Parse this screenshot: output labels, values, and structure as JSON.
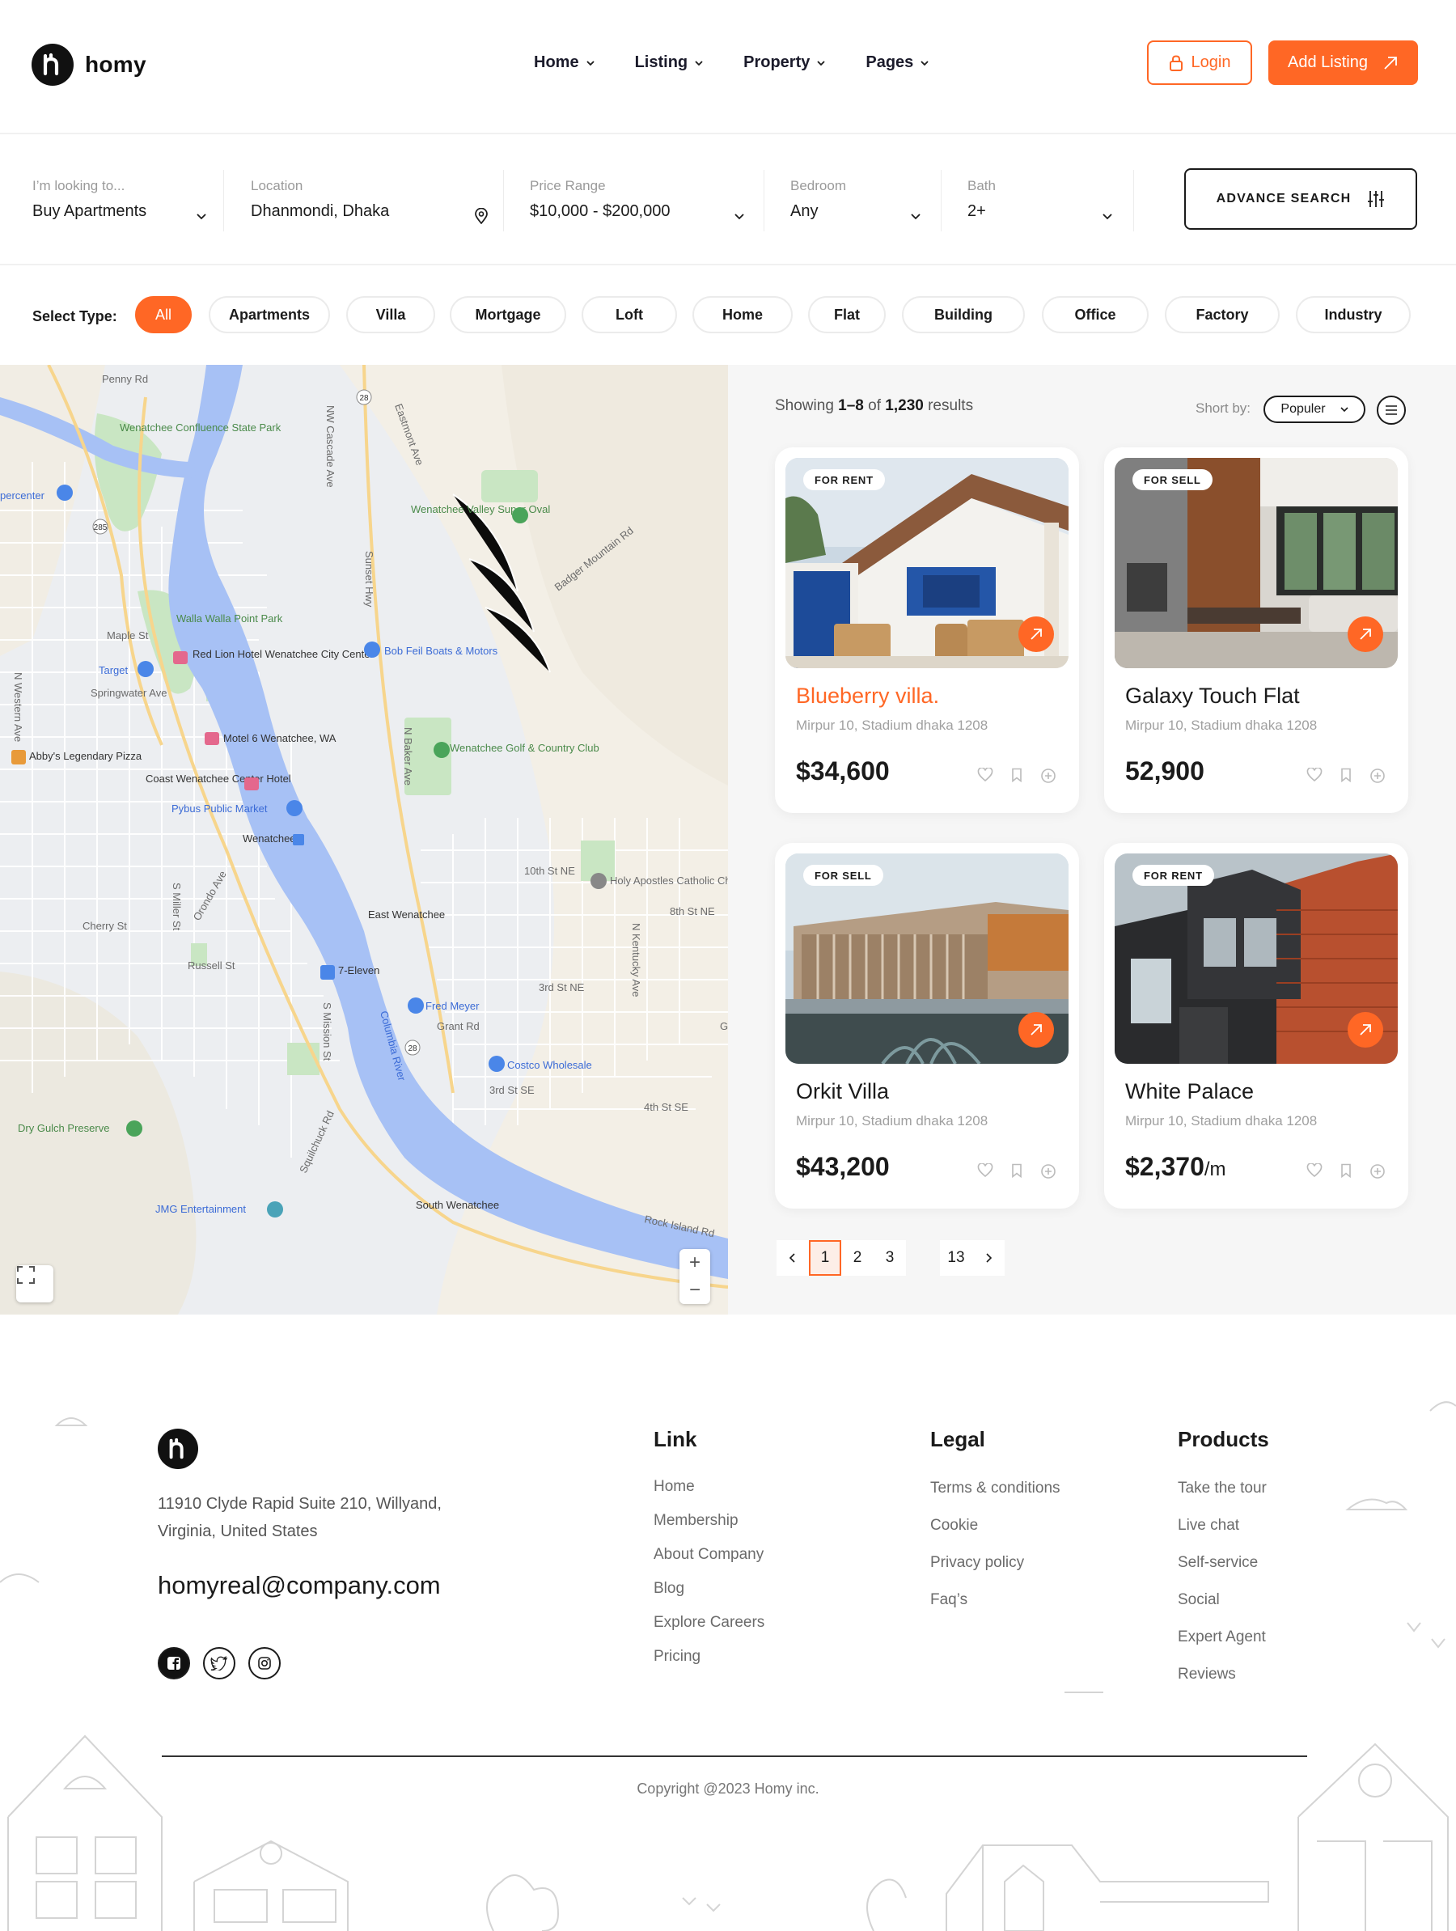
{
  "brand": {
    "name": "homy"
  },
  "nav": [
    {
      "label": "Home"
    },
    {
      "label": "Listing"
    },
    {
      "label": "Property"
    },
    {
      "label": "Pages"
    }
  ],
  "header": {
    "login_label": "Login",
    "add_listing_label": "Add Listing"
  },
  "search": {
    "looking": {
      "label": "I’m looking to...",
      "value": "Buy Apartments"
    },
    "location": {
      "label": "Location",
      "value": "Dhanmondi, Dhaka"
    },
    "price": {
      "label": "Price Range",
      "value": "$10,000 - $200,000"
    },
    "bedroom": {
      "label": "Bedroom",
      "value": "Any"
    },
    "bath": {
      "label": "Bath",
      "value": "2+"
    },
    "advance_label": "ADVANCE SEARCH"
  },
  "types": {
    "label": "Select Type:",
    "items": [
      "All",
      "Apartments",
      "Villa",
      "Mortgage",
      "Loft",
      "Home",
      "Flat",
      "Building",
      "Office",
      "Factory",
      "Industry"
    ],
    "active": "All"
  },
  "map": {
    "labels": [
      "Penny Rd",
      "Wenatchee Confluence State Park",
      "percenter",
      "Wenatchee Valley Super Oval",
      "Badger Mountain Rd",
      "Walla Walla Point Park",
      "Maple St",
      "Red Lion Hotel Wenatchee City Center",
      "Bob Feil Boats & Motors",
      "Target",
      "Springwater Ave",
      "Motel 6 Wenatchee, WA",
      "Wenatchee Golf & Country Club",
      "Abby's Legendary Pizza",
      "Coast Wenatchee Center Hotel",
      "Pybus Public Market",
      "Wenatchee",
      "10th St NE",
      "Holy Apostles Catholic Church",
      "8th St NE",
      "East Wenatchee",
      "Cherry St",
      "Russell St",
      "7-Eleven",
      "3rd St NE",
      "Fred Meyer",
      "Grant Rd",
      "Costco Wholesale",
      "3rd St SE",
      "4th St SE",
      "Dry Gulch Preserve",
      "JMG Entertainment",
      "South Wenatchee",
      "Rock Island Rd",
      "N Western Ave",
      "NW Cascade Ave",
      "Sunset Hwy",
      "Eastmont Ave",
      "N Baker Ave",
      "S Miller St",
      "Orondo Ave",
      "S Mission St",
      "Columbia River",
      "Squilchuck Rd",
      "N Kentucky Ave",
      "Gr"
    ],
    "road_shields": [
      "28",
      "285",
      "28"
    ],
    "zoom_in": "+",
    "zoom_out": "−"
  },
  "results": {
    "showing_prefix": "Showing ",
    "range": "1–8",
    "of": " of ",
    "total": "1,230",
    "suffix": " results",
    "sort_label": "Short by:",
    "sort_value": "Populer"
  },
  "listings": [
    {
      "badge": "FOR RENT",
      "title": "Blueberry villa.",
      "address": "Mirpur 10, Stadium dhaka 1208",
      "price": "$34,600",
      "unit": "",
      "highlight": true
    },
    {
      "badge": "FOR SELL",
      "title": "Galaxy Touch Flat",
      "address": "Mirpur 10, Stadium dhaka 1208",
      "price": "52,900",
      "unit": "",
      "highlight": false
    },
    {
      "badge": "FOR SELL",
      "title": "Orkit Villa",
      "address": "Mirpur 10, Stadium dhaka 1208",
      "price": "$43,200",
      "unit": "",
      "highlight": false
    },
    {
      "badge": "FOR RENT",
      "title": "White Palace",
      "address": "Mirpur 10, Stadium dhaka 1208",
      "price": "$2,370",
      "unit": "/m",
      "highlight": false
    }
  ],
  "pagination": {
    "pages": [
      "1",
      "2",
      "3"
    ],
    "last": "13",
    "current": "1"
  },
  "footer": {
    "address": "11910 Clyde Rapid Suite 210, Willyand, Virginia, United States",
    "email": "homyreal@company.com",
    "link": {
      "title": "Link",
      "items": [
        "Home",
        "Membership",
        "About Company",
        "Blog",
        "Explore Careers",
        "Pricing"
      ]
    },
    "legal": {
      "title": "Legal",
      "items": [
        "Terms & conditions",
        "Cookie",
        "Privacy policy",
        "Faq’s"
      ]
    },
    "products": {
      "title": "Products",
      "items": [
        "Take the tour",
        "Live chat",
        "Self-service",
        "Social",
        "Expert Agent",
        "Reviews"
      ]
    },
    "copyright": "Copyright @2023 Homy inc."
  },
  "colors": {
    "accent": "#ff6725",
    "dark": "#1b1b1b",
    "muted": "#a0a0a0",
    "map_water": "#a7c1f5",
    "map_park": "#c9e6c3"
  }
}
